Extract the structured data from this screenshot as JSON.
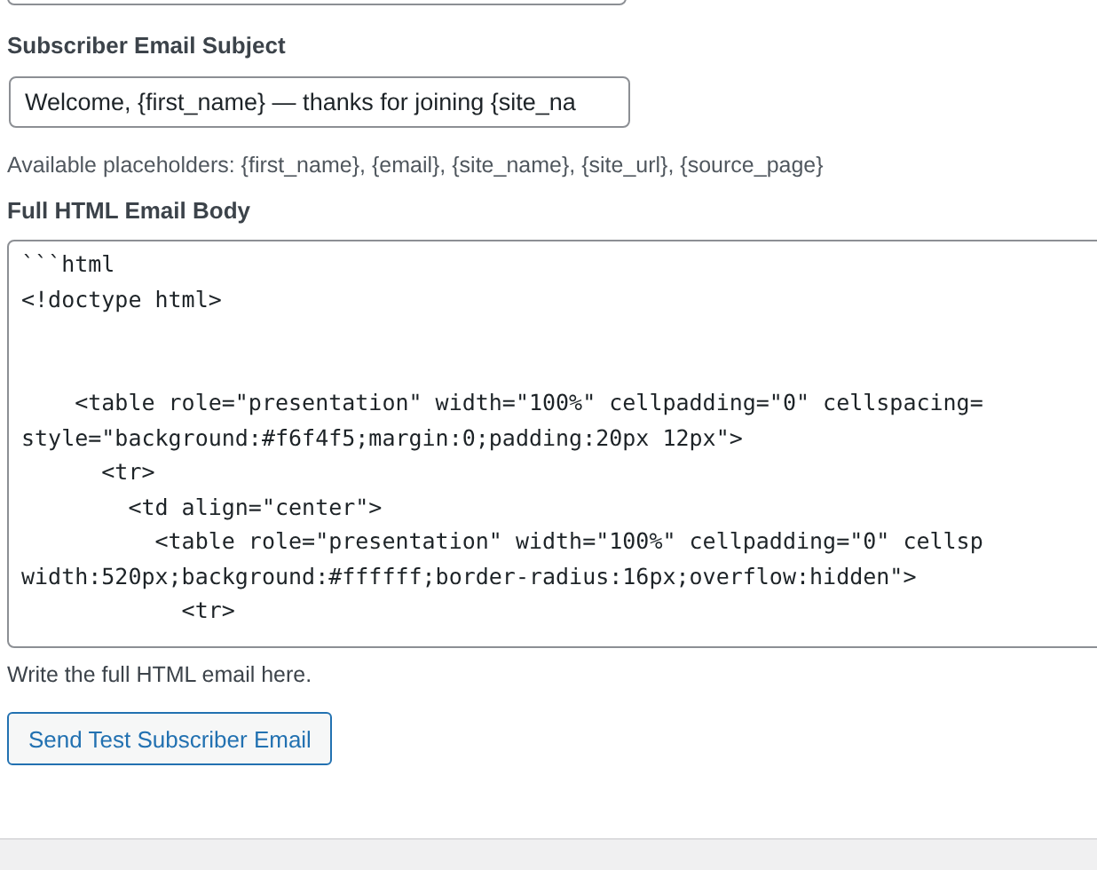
{
  "subject": {
    "label": "Subscriber Email Subject",
    "value": "Welcome, {first_name} — thanks for joining {site_na",
    "help": "Available placeholders: {first_name}, {email}, {site_name}, {site_url}, {source_page}"
  },
  "body": {
    "label": "Full HTML Email Body",
    "value": "```html\n<!doctype html>\n\n\n    <table role=\"presentation\" width=\"100%\" cellpadding=\"0\" cellspacing=\nstyle=\"background:#f6f4f5;margin:0;padding:20px 12px\">\n      <tr>\n        <td align=\"center\">\n          <table role=\"presentation\" width=\"100%\" cellpadding=\"0\" cellsp\nwidth:520px;background:#ffffff;border-radius:16px;overflow:hidden\">\n            <tr>",
    "help": "Write the full HTML email here."
  },
  "button": {
    "label": "Send Test Subscriber Email"
  }
}
